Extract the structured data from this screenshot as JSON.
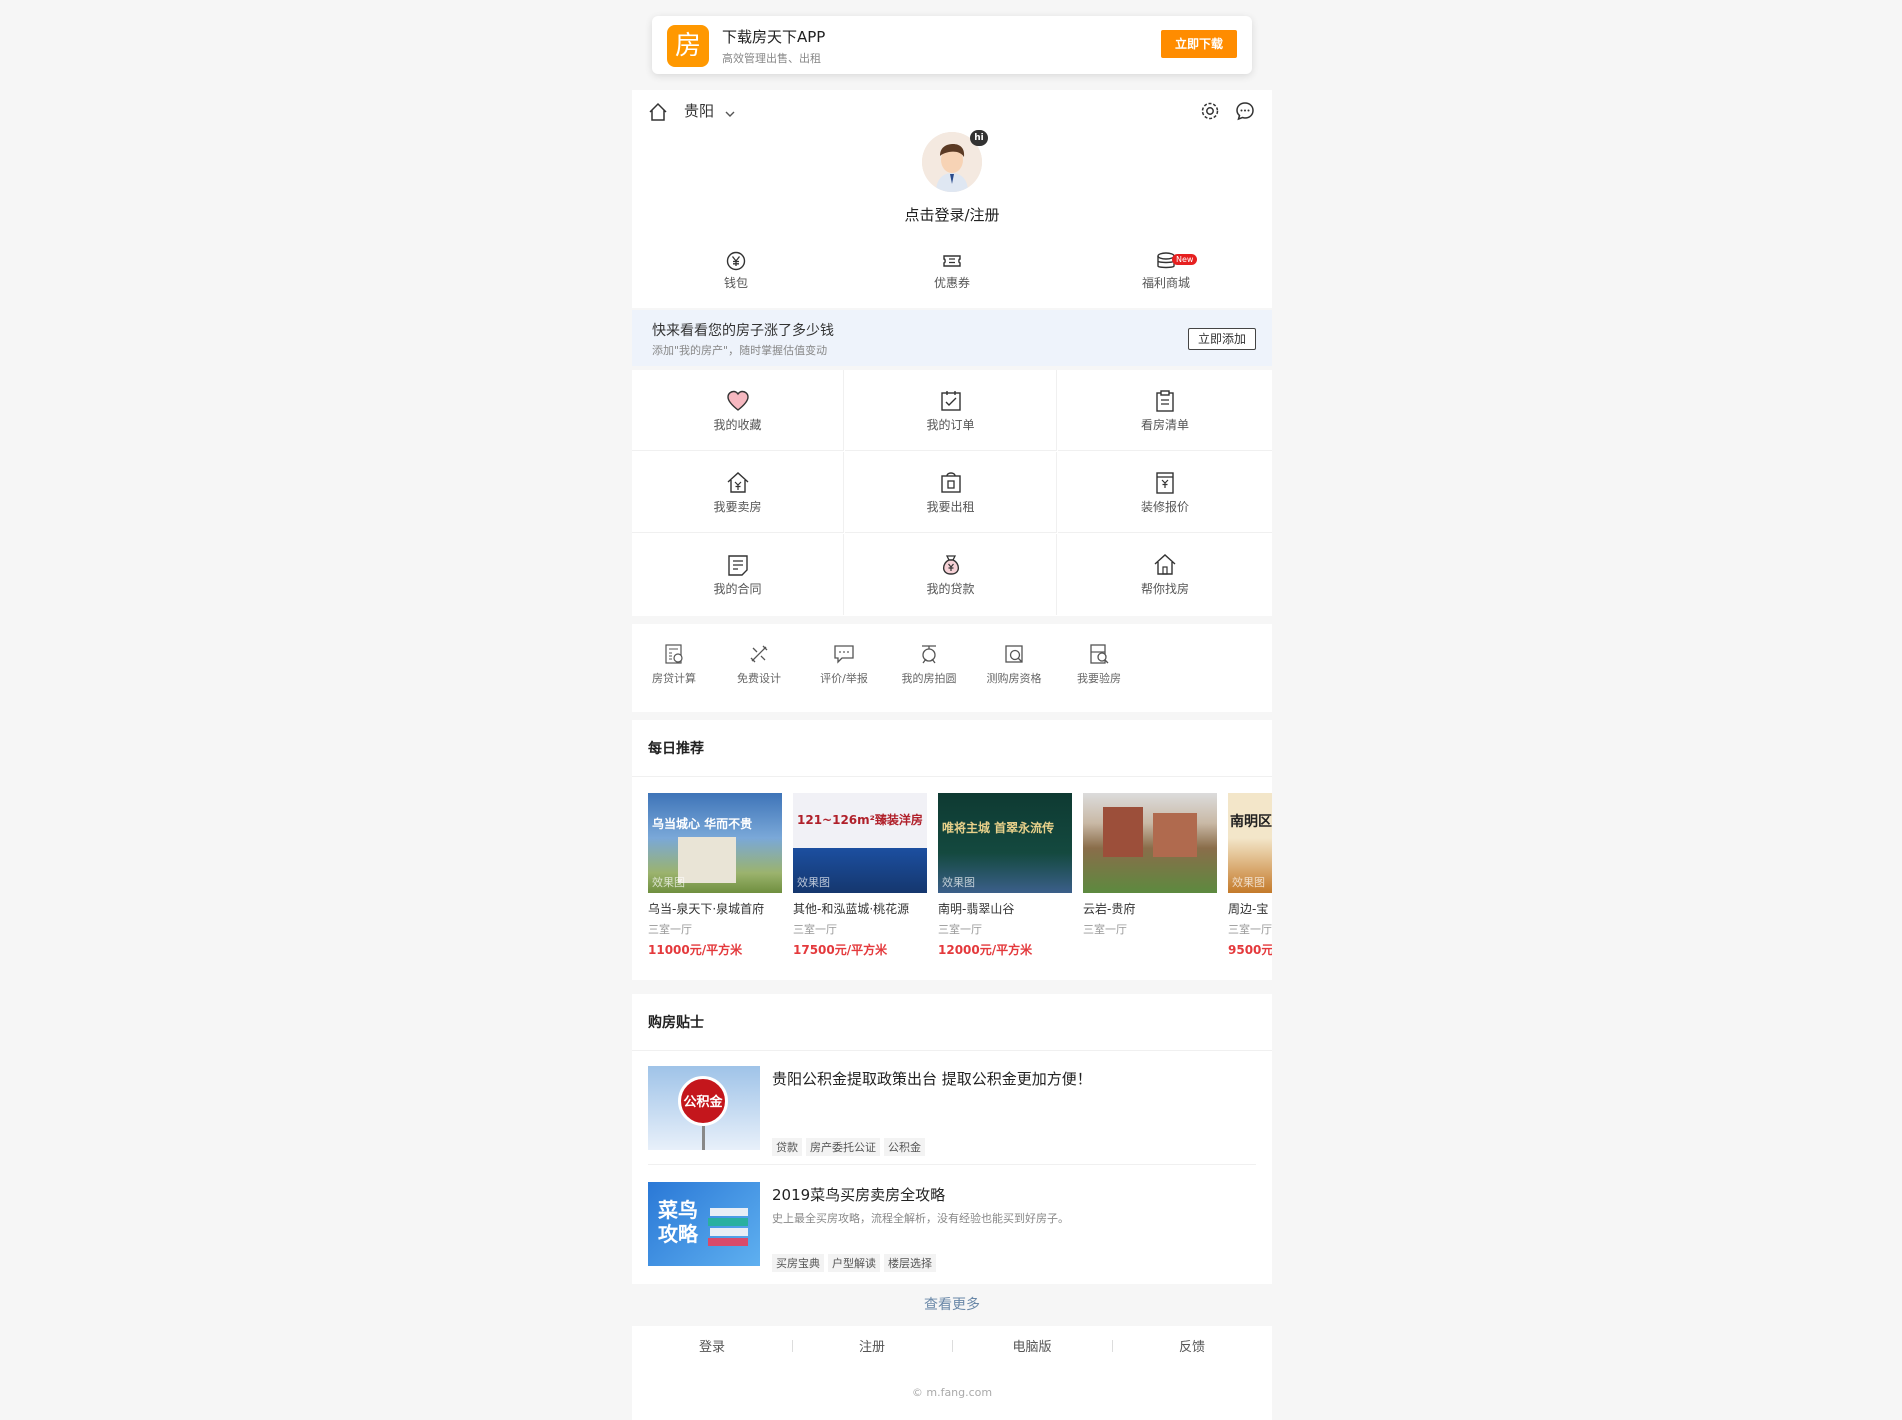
{
  "banner": {
    "logo_char": "房",
    "title": "下载房天下APP",
    "subtitle": "高效管理出售、出租",
    "button": "立即下载"
  },
  "header": {
    "city": "贵阳",
    "avatar_badge": "hi",
    "login_link": "点击登录/注册"
  },
  "wallet": {
    "items": [
      {
        "label": "钱包",
        "icon": "yen-icon"
      },
      {
        "label": "优惠券",
        "icon": "ticket-icon"
      },
      {
        "label": "福利商城",
        "icon": "coins-icon",
        "badge": "New"
      }
    ]
  },
  "value_bar": {
    "title": "快来看看您的房子涨了多少钱",
    "subtitle": "添加\"我的房产\"，随时掌握估值变动",
    "button": "立即添加"
  },
  "grid": {
    "items": [
      {
        "label": "我的收藏",
        "icon": "heart-icon"
      },
      {
        "label": "我的订单",
        "icon": "order-icon"
      },
      {
        "label": "看房清单",
        "icon": "clipboard-icon"
      },
      {
        "label": "我要卖房",
        "icon": "house-yen-icon"
      },
      {
        "label": "我要出租",
        "icon": "rent-icon"
      },
      {
        "label": "装修报价",
        "icon": "quote-icon"
      },
      {
        "label": "我的合同",
        "icon": "contract-icon"
      },
      {
        "label": "我的贷款",
        "icon": "money-bag-icon"
      },
      {
        "label": "帮你找房",
        "icon": "find-house-icon"
      }
    ]
  },
  "tools": {
    "items": [
      {
        "label": "房贷计算",
        "icon": "calculator-icon"
      },
      {
        "label": "免费设计",
        "icon": "design-icon"
      },
      {
        "label": "评价/举报",
        "icon": "comment-icon"
      },
      {
        "label": "我的房拍圆",
        "icon": "camera-icon"
      },
      {
        "label": "测购房资格",
        "icon": "qualify-icon"
      },
      {
        "label": "我要验房",
        "icon": "inspect-icon"
      }
    ]
  },
  "daily": {
    "title": "每日推荐",
    "cards": [
      {
        "name": "乌当-泉天下·泉城首府",
        "type": "三室一厅",
        "price": "11000元/平方米",
        "img_text": "乌当城心 华而不贵",
        "tag": "效果图",
        "color": "#3e74b8"
      },
      {
        "name": "其他-和泓蓝城·桃花源",
        "type": "三室一厅",
        "price": "17500元/平方米",
        "img_text": "121~126m²臻装洋房",
        "tag": "效果图",
        "color": "#1c4fa0"
      },
      {
        "name": "南明-翡翠山谷",
        "type": "三室一厅",
        "price": "12000元/平方米",
        "img_text": "唯将主城 首翠永流传",
        "tag": "效果图",
        "color": "#0e3a32"
      },
      {
        "name": "云岩-贵府",
        "type": "三室一厅",
        "price": "",
        "img_text": "",
        "tag": "",
        "color": "#8a6d4a"
      },
      {
        "name": "周边-宝",
        "type": "三室一厅",
        "price": "9500元/",
        "img_text": "南明区",
        "tag": "效果图",
        "color": "#c47a2a"
      }
    ]
  },
  "tips": {
    "title": "购房贴士",
    "items": [
      {
        "title": "贵阳公积金提取政策出台 提取公积金更加方便！",
        "subtitle": "",
        "thumb_text": "公积金",
        "tags": [
          "贷款",
          "房产委托公证",
          "公积金"
        ]
      },
      {
        "title": "2019菜鸟买房卖房全攻略",
        "subtitle": "史上最全买房攻略，流程全解析，没有经验也能买到好房子。",
        "thumb_text": "菜鸟攻略",
        "tags": [
          "买房宝典",
          "户型解读",
          "楼层选择"
        ]
      }
    ]
  },
  "more_link": "查看更多",
  "footer": {
    "links": [
      "登录",
      "注册",
      "电脑版",
      "反馈"
    ],
    "copyright": "© m.fang.com"
  },
  "colors": {
    "accent": "#ff8c00",
    "price": "#e4393c",
    "value_bar_bg": "#eef3fb"
  }
}
